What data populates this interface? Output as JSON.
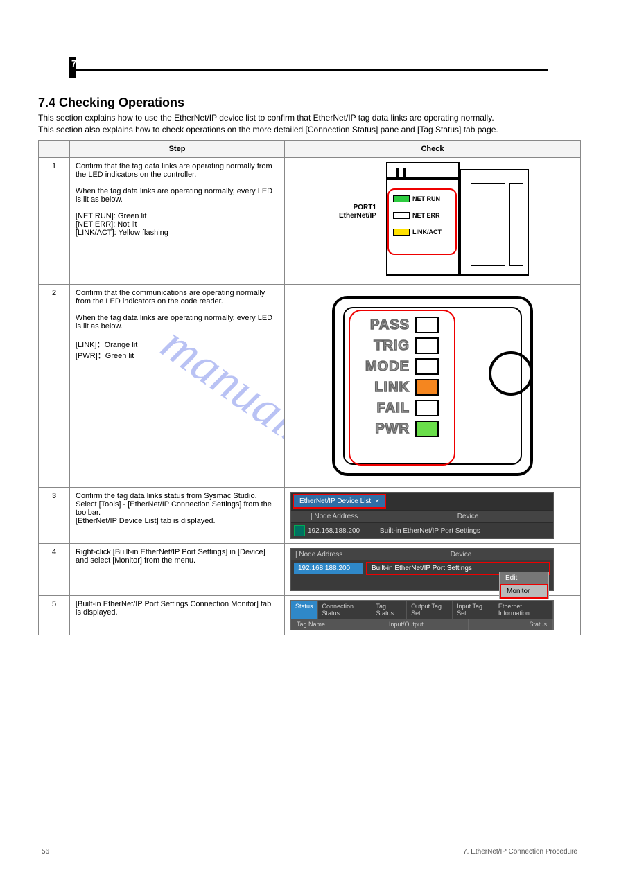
{
  "watermark": "manualshive.com",
  "chapter_label": "7",
  "section_title": "7.4 Checking Operations",
  "section_sub1": "This section explains how to use the EtherNet/IP device list to confirm that EtherNet/IP tag data links are operating normally.",
  "section_sub2": "This section also explains how to check operations on the more detailed [Connection Status] pane and [Tag Status] tab page.",
  "table": {
    "headers": [
      "",
      "Step",
      "Check"
    ],
    "rows": [
      {
        "step": "1",
        "desc_title": "Confirm that the tag data links are operating normally from the LED indicators on the controller.",
        "desc_body": "When the tag data links are operating normally, every LED is lit as below.\n\n[NET RUN]: Green lit\n[NET ERR]: Not lit\n[LINK/ACT]: Yellow flashing"
      },
      {
        "step": "2",
        "desc_title": "Confirm that the communications are operating normally from the LED indicators on the code reader.",
        "desc_body": "When the tag data links are operating normally, every LED is lit as below.\n\n[LINK]：Orange lit\n[PWR]：Green lit"
      },
      {
        "step": "3",
        "desc_title": "Confirm the tag data links status from Sysmac Studio.",
        "desc_body": "Select [Tools] - [EtherNet/IP Connection Settings] from the toolbar.\n[EtherNet/IP Device List] tab is displayed."
      },
      {
        "step": "4",
        "desc_title": "",
        "desc_body": "Right-click [Built-in EtherNet/IP Port Settings] in [Device] and select [Monitor] from the menu."
      },
      {
        "step": "5",
        "desc_title": "",
        "desc_body": "[Built-in EtherNet/IP Port Settings Connection Monitor] tab is displayed."
      }
    ]
  },
  "diagram1": {
    "left_label1": "PORT1",
    "left_label2": "EtherNet/IP",
    "leds": [
      {
        "name": "NET RUN",
        "color": "#2ecc40"
      },
      {
        "name": "NET ERR",
        "color": "#ffffff"
      },
      {
        "name": "LINK/ACT",
        "color": "#ffe100"
      }
    ]
  },
  "diagram2": {
    "rows": [
      {
        "label": "PASS",
        "color": "#ffffff"
      },
      {
        "label": "TRIG",
        "color": "#ffffff"
      },
      {
        "label": "MODE",
        "color": "#ffffff"
      },
      {
        "label": "LINK",
        "color": "#f5861f"
      },
      {
        "label": "FAIL",
        "color": "#ffffff"
      },
      {
        "label": "PWR",
        "color": "#6ade4a"
      }
    ]
  },
  "shot3": {
    "tab_label": "EtherNet/IP Device List",
    "close_glyph": "×",
    "col_node": "Node Address",
    "col_device": "Device",
    "ip": "192.168.188.200",
    "dev": "Built-in EtherNet/IP Port Settings"
  },
  "shot4": {
    "col_node": "Node Address",
    "col_device": "Device",
    "ip": "192.168.188.200",
    "dev": "Built-in EtherNet/IP Port Settings",
    "menu": {
      "edit": "Edit",
      "monitor": "Monitor"
    }
  },
  "shot5": {
    "tabs": [
      "Status",
      "Connection Status",
      "Tag Status",
      "Output Tag Set",
      "Input Tag Set",
      "Ethernet Information"
    ],
    "row2": [
      "Tag Name",
      "Input/Output",
      "Status"
    ]
  },
  "footer": {
    "left": "56",
    "right": "7. EtherNet/IP Connection Procedure"
  }
}
